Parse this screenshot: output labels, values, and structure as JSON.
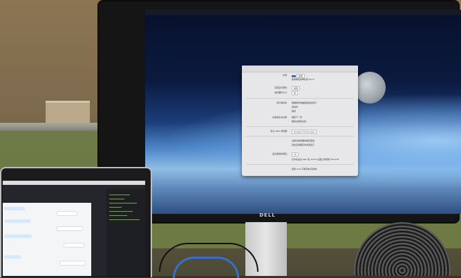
{
  "monitor": {
    "brand": "DELL",
    "dialog": {
      "rows": [
        {
          "label": "外观:",
          "value": "蓝色"
        },
        {
          "label": "",
          "value": "使用暗色菜单栏和 Dock"
        },
        {
          "label": "高亮显示颜色:",
          "value": "蓝色"
        },
        {
          "label": "边栏图标大小:",
          "value": "中"
        },
        {
          "label": "显示滚动条:",
          "value": "根据鼠标或触控板自动显示"
        },
        {
          "label": "",
          "value": "滚动时"
        },
        {
          "label": "",
          "value": "始终"
        },
        {
          "label": "在滚动条中点按:",
          "value": "跳至下一页"
        },
        {
          "label": "",
          "value": "跳到点按的位置"
        },
        {
          "label": "默认 Web 浏览器:",
          "value": "Google Chrome.app"
        },
        {
          "label": "",
          "value": "关闭文稿时要求保存更改"
        },
        {
          "label": "",
          "value": "退出应用程序时关闭窗口"
        },
        {
          "label": "最近使用的项目:",
          "value": "10"
        },
        {
          "label": "",
          "value": "允许在这台 Mac 和 iCloud 设备之间使用 Handoff"
        },
        {
          "label": "",
          "value": "使用 LCD 平滑字体(可用时)"
        }
      ]
    }
  }
}
